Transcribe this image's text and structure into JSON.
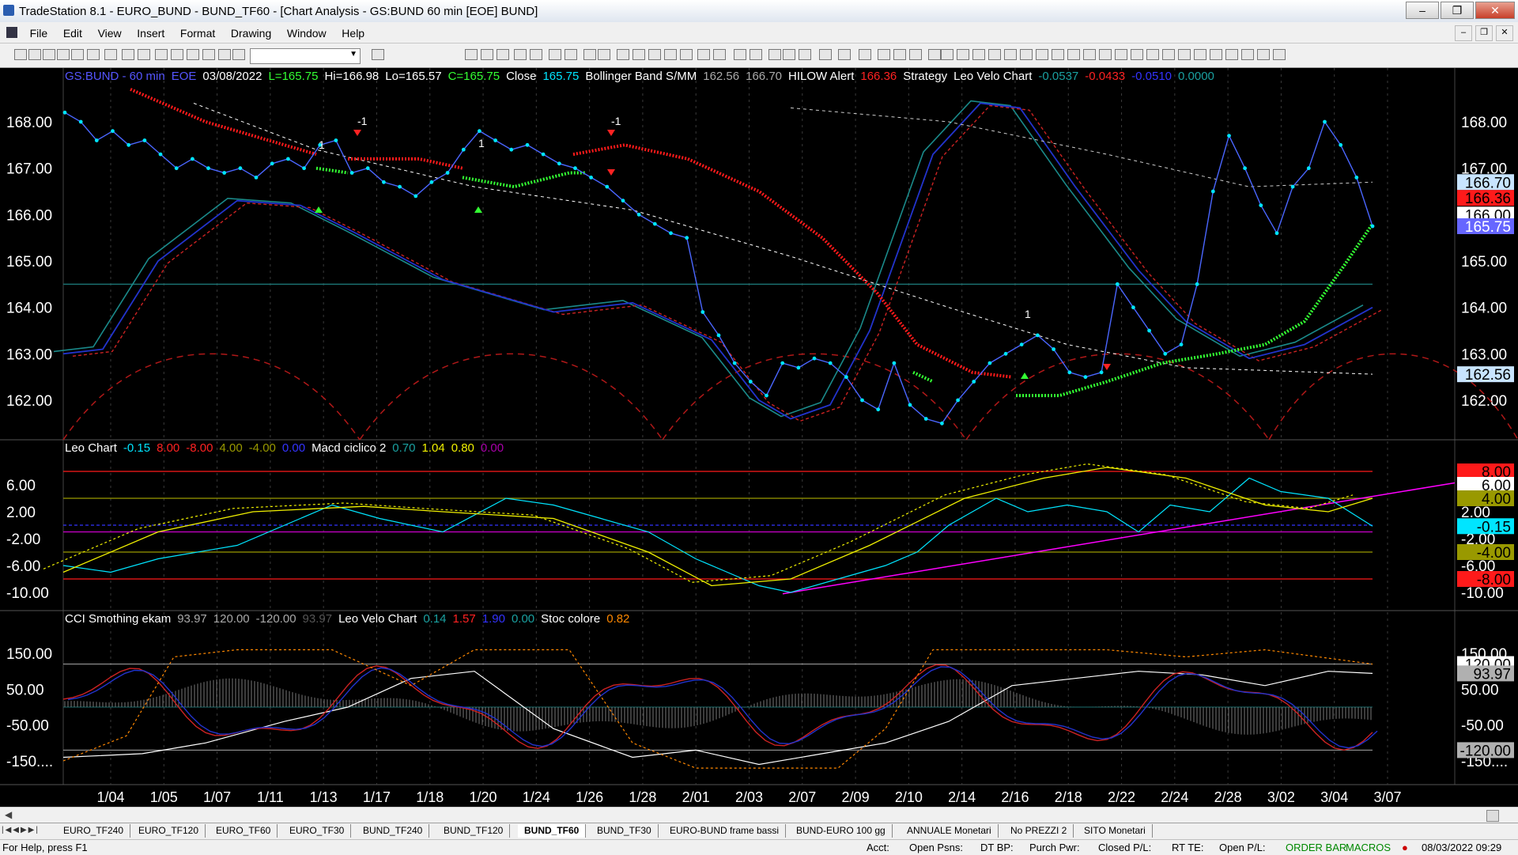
{
  "window": {
    "title": "TradeStation 8.1 - EURO_BUND - BUND_TF60 - [Chart Analysis - GS:BUND  60 min  [EOE] BUND]",
    "minimize": "‒",
    "restore": "❐",
    "close": "✕"
  },
  "menu": [
    "File",
    "Edit",
    "View",
    "Insert",
    "Format",
    "Drawing",
    "Window",
    "Help"
  ],
  "colors": {
    "bg": "#000000",
    "price": "#00e5ff",
    "bollinger": "#7777ff",
    "bb_mid": "#ffffff",
    "stop_red": "#ff1a1a",
    "stop_green": "#33ff33",
    "ma_blue": "#2233cc",
    "ma_teal": "#1a8a8a",
    "ma_red": "#cc2222",
    "cycle_dash": "#b01818",
    "level_teal": "#1a7070",
    "axis_text": "#ffffff",
    "magenta": "#ff00ff",
    "yellow": "#f0f000"
  },
  "price_panel": {
    "header": [
      {
        "t": "GS:BUND - 60 min",
        "c": "#5555ff"
      },
      {
        "t": "EOE",
        "c": "#5555ff"
      },
      {
        "t": "03/08/2022",
        "c": "#ffffff"
      },
      {
        "t": "L=165.75",
        "c": "#33ff33"
      },
      {
        "t": "Hi=166.98",
        "c": "#ffffff"
      },
      {
        "t": "Lo=165.57",
        "c": "#ffffff"
      },
      {
        "t": "C=165.75",
        "c": "#33ff33"
      },
      {
        "t": "Close",
        "c": "#ffffff"
      },
      {
        "t": "165.75",
        "c": "#00e5ff"
      },
      {
        "t": "Bollinger Band S/MM",
        "c": "#ffffff"
      },
      {
        "t": "162.56",
        "c": "#aaaaaa"
      },
      {
        "t": "166.70",
        "c": "#aaaaaa"
      },
      {
        "t": "HILOW Alert",
        "c": "#ffffff"
      },
      {
        "t": "166.36",
        "c": "#ff2222"
      },
      {
        "t": "Strategy",
        "c": "#ffffff"
      },
      {
        "t": "Leo Velo Chart",
        "c": "#ffffff"
      },
      {
        "t": "-0.0537",
        "c": "#1aa0a0"
      },
      {
        "t": "-0.0433",
        "c": "#ff2222"
      },
      {
        "t": "-0.0510",
        "c": "#3333ff"
      },
      {
        "t": "0.0000",
        "c": "#1aa0a0"
      }
    ],
    "y_ticks": [
      "168.00",
      "167.00",
      "166.00",
      "165.00",
      "164.00",
      "163.00",
      "162.00"
    ],
    "y_values": [
      168,
      167,
      166,
      165,
      164,
      163,
      162
    ],
    "tags": [
      {
        "v": 166.7,
        "t": "166.70",
        "bg": "#c8e4ff",
        "fg": "#000000"
      },
      {
        "v": 166.36,
        "t": "166.36",
        "bg": "#ff1a1a",
        "fg": "#000000"
      },
      {
        "v": 166.0,
        "t": "166.00",
        "bg": "#ffffff",
        "fg": "#000000"
      },
      {
        "v": 165.75,
        "t": "165.75",
        "bg": "#6666ff",
        "fg": "#ffffff"
      },
      {
        "v": 162.56,
        "t": "162.56",
        "bg": "#c8e4ff",
        "fg": "#000000"
      }
    ],
    "markers": [
      {
        "t": "-1",
        "x": 452,
        "y": 72
      },
      {
        "t": "1",
        "x": 403,
        "y": 102
      },
      {
        "t": "1",
        "x": 605,
        "y": 100
      },
      {
        "t": "-1",
        "x": 773,
        "y": 72
      },
      {
        "t": "1",
        "x": 1296,
        "y": 316
      }
    ]
  },
  "osc_panel": {
    "header": [
      {
        "t": "Leo Chart",
        "c": "#ffffff"
      },
      {
        "t": "-0.15",
        "c": "#00e5ff"
      },
      {
        "t": "8.00",
        "c": "#ff2222"
      },
      {
        "t": "-8.00",
        "c": "#ff2222"
      },
      {
        "t": "4.00",
        "c": "#999900"
      },
      {
        "t": "-4.00",
        "c": "#999900"
      },
      {
        "t": "0.00",
        "c": "#3333ff"
      },
      {
        "t": "Macd ciclico 2",
        "c": "#ffffff"
      },
      {
        "t": "0.70",
        "c": "#1aa0a0"
      },
      {
        "t": "1.04",
        "c": "#f0f000"
      },
      {
        "t": "0.80",
        "c": "#f0f000"
      },
      {
        "t": "0.00",
        "c": "#aa00aa"
      }
    ],
    "y_ticks": [
      "6.00",
      "2.00",
      "-2.00",
      "-6.00",
      "-10.00"
    ],
    "y_values": [
      6,
      2,
      -2,
      -6,
      -10
    ],
    "tags": [
      {
        "v": 8,
        "t": "8.00",
        "bg": "#ff1a1a",
        "fg": "#000000"
      },
      {
        "v": 6,
        "t": "6.00",
        "bg": "#ffffff",
        "fg": "#000000"
      },
      {
        "v": 4,
        "t": "4.00",
        "bg": "#999900",
        "fg": "#000000"
      },
      {
        "v": -0.15,
        "t": "-0.15",
        "bg": "#00e5ff",
        "fg": "#000000"
      },
      {
        "v": -4,
        "t": "-4.00",
        "bg": "#999900",
        "fg": "#000000"
      },
      {
        "v": -8,
        "t": "-8.00",
        "bg": "#ff1a1a",
        "fg": "#000000"
      }
    ]
  },
  "cci_panel": {
    "header": [
      {
        "t": "CCI Smothing ekam",
        "c": "#ffffff"
      },
      {
        "t": "93.97",
        "c": "#aaaaaa"
      },
      {
        "t": "120.00",
        "c": "#aaaaaa"
      },
      {
        "t": "-120.00",
        "c": "#aaaaaa"
      },
      {
        "t": "93.97",
        "c": "#555555"
      },
      {
        "t": "Leo Velo Chart",
        "c": "#ffffff"
      },
      {
        "t": "0.14",
        "c": "#1aa0a0"
      },
      {
        "t": "1.57",
        "c": "#ff2222"
      },
      {
        "t": "1.90",
        "c": "#3333ff"
      },
      {
        "t": "0.00",
        "c": "#1aa0a0"
      },
      {
        "t": "Stoc colore",
        "c": "#ffffff"
      },
      {
        "t": "0.82",
        "c": "#ff8800"
      }
    ],
    "y_ticks": [
      "150.00",
      "50.00",
      "-50.00",
      "-150...."
    ],
    "y_values": [
      150,
      50,
      -50,
      -150
    ],
    "tags": [
      {
        "v": 120,
        "t": "120.00",
        "bg": "#ffffff",
        "fg": "#000000"
      },
      {
        "v": 93.97,
        "t": "93.97",
        "bg": "#b0b0b0",
        "fg": "#000000"
      },
      {
        "v": -120,
        "t": "-120.00",
        "bg": "#b0b0b0",
        "fg": "#000000"
      }
    ]
  },
  "x_axis": [
    "1/04",
    "1/05",
    "1/07",
    "1/11",
    "1/13",
    "1/17",
    "1/18",
    "1/20",
    "1/24",
    "1/26",
    "1/28",
    "2/01",
    "2/03",
    "2/07",
    "2/09",
    "2/10",
    "2/14",
    "2/16",
    "2/18",
    "2/22",
    "2/24",
    "2/28",
    "3/02",
    "3/04",
    "3/07"
  ],
  "chart_data": {
    "type": "line",
    "series": [
      {
        "values": [
          168.2,
          168.0,
          167.6,
          167.8,
          167.5,
          167.6,
          167.3,
          167.0,
          167.2,
          167.0,
          166.9,
          167.0,
          166.8,
          167.1,
          167.2,
          167.0,
          167.5,
          167.6,
          166.9,
          167.0,
          166.7,
          166.6,
          166.4,
          166.7,
          166.9,
          167.4,
          167.8,
          167.6,
          167.4,
          167.5,
          167.3,
          167.1,
          167.0,
          166.8,
          166.6,
          166.3,
          166.0,
          165.8,
          165.6,
          165.5,
          163.9,
          163.4,
          162.8,
          162.4,
          162.1,
          162.8,
          162.7,
          162.9,
          162.8,
          162.5,
          162.0,
          161.8,
          162.8,
          161.9,
          161.6,
          161.5,
          162.0,
          162.4,
          162.8,
          163.0,
          163.2,
          163.4,
          163.1,
          162.6,
          162.5,
          162.6,
          164.5,
          164.0,
          163.5,
          163.0,
          163.2,
          164.5,
          166.5,
          167.7,
          167.0,
          166.2,
          165.6,
          166.6,
          167.0,
          168.0,
          167.5,
          166.8,
          165.75
        ]
      }
    ]
  },
  "tabs": [
    "EURO_TF240",
    "EURO_TF120",
    "EURO_TF60",
    "EURO_TF30",
    "BUND_TF240",
    "BUND_TF120",
    "BUND_TF60",
    "BUND_TF30",
    "EURO-BUND frame bassi",
    "BUND-EURO 100 gg",
    "ANNUALE Monetari",
    "No PREZZI 2",
    "SITO Monetari"
  ],
  "active_tab": "BUND_TF60",
  "status": {
    "help": "For Help, press F1",
    "acct": "Acct:",
    "open_psns": "Open Psns:",
    "dt_bp": "DT BP:",
    "purch_pwr": "Purch Pwr:",
    "closed_pl": "Closed P/L:",
    "rt_te": "RT TE:",
    "open_pl": "Open P/L:",
    "order_bar": "ORDER BAR",
    "macros": "MACROS",
    "datetime": "08/03/2022 09:29"
  }
}
